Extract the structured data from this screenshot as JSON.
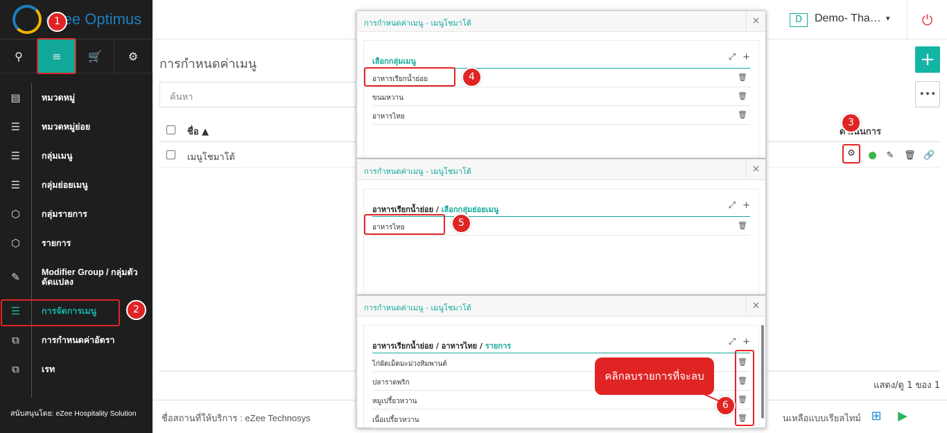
{
  "app": {
    "name": "eZee Optimus"
  },
  "sidebar": {
    "top_icons": [
      {
        "icon": "user-icon",
        "glyph": "⚲"
      },
      {
        "icon": "menu-lines-icon",
        "glyph": "≡"
      },
      {
        "icon": "cart-icon",
        "glyph": "🛒"
      },
      {
        "icon": "gear-icon",
        "glyph": "⚙"
      }
    ],
    "items": [
      {
        "label": "หมวดหมู่",
        "glyph": "▤"
      },
      {
        "label": "หมวดหมู่ย่อย",
        "glyph": "☰"
      },
      {
        "label": "กลุ่มเมนู",
        "glyph": "☰"
      },
      {
        "label": "กลุ่มย่อยเมนู",
        "glyph": "☰"
      },
      {
        "label": "กลุ่มรายการ",
        "glyph": "⬡"
      },
      {
        "label": "รายการ",
        "glyph": "⬡"
      },
      {
        "label": "Modifier Group / กลุ่มตัวดัดแปลง",
        "glyph": "✎"
      },
      {
        "label": "การจัดการเมนู",
        "glyph": "☰"
      },
      {
        "label": "การกำหนดค่าอัตรา",
        "glyph": "⧉"
      },
      {
        "label": "เรท",
        "glyph": "⧉"
      }
    ],
    "footer": "สนับสนุนโดย: eZee Hospitality Solution"
  },
  "topbar": {
    "property_initial": "D",
    "property_name": "Demo- Tha…",
    "caret": "▾",
    "power": "⏻"
  },
  "main": {
    "title": "การกำหนดค่าเมนู",
    "add": "+",
    "more": "•••",
    "search_placeholder": "ค้นหา",
    "col_name": "ชื่อ ▲",
    "col_action": "ดำเนินการ",
    "rows": [
      {
        "name": "เมนูโชมาโต้"
      }
    ],
    "action_icons": {
      "gear": "⚙",
      "edit": "✎",
      "trash": "🗑",
      "link": "🔗"
    },
    "paging": "แสดง/ดู 1 ของ 1"
  },
  "footer": {
    "text": "ชื่อสถานที่ให้บริการ : eZee Technosys",
    "right": "นเหลือแบบเรียลไทม์",
    "stores": [
      "⊞",
      "▶",
      ""
    ]
  },
  "dialogs": [
    {
      "title": "การกำหนดค่าเมนู - เมนูโชมาโต้",
      "crumb": "",
      "crumb_sel": "เลือกกลุ่มเมนู",
      "items": [
        "อาหารเรียกน้ำย่อย",
        "ขนมหวาน",
        "อาหารไทย"
      ]
    },
    {
      "title": "การกำหนดค่าเมนู - เมนูโชมาโต้",
      "crumb": "อาหารเรียกน้ำย่อย /",
      "crumb_sel": "เลือกกลุ่มย่อยเมนู",
      "items": [
        "อาหารไทย"
      ]
    },
    {
      "title": "การกำหนดค่าเมนู - เมนูโชมาโต้",
      "crumb": "อาหารเรียกน้ำย่อย /  อาหารไทย /",
      "crumb_sel": "รายการ",
      "items": [
        "ไก่ผัดเม็ดมะม่วงหิมพานต์",
        "ปลาราดพริก",
        "หมูเปรี้ยวหวาน",
        "เนื้อเปรี้ยวหวาน"
      ]
    }
  ],
  "dialog_tools": {
    "sort": "⤢",
    "add": "+",
    "close": "×",
    "trash": "🗑"
  },
  "annotations": {
    "steps": [
      "1",
      "2",
      "3",
      "4",
      "5",
      "6"
    ],
    "callout": "คลิกลบรายการที่จะลบ"
  }
}
